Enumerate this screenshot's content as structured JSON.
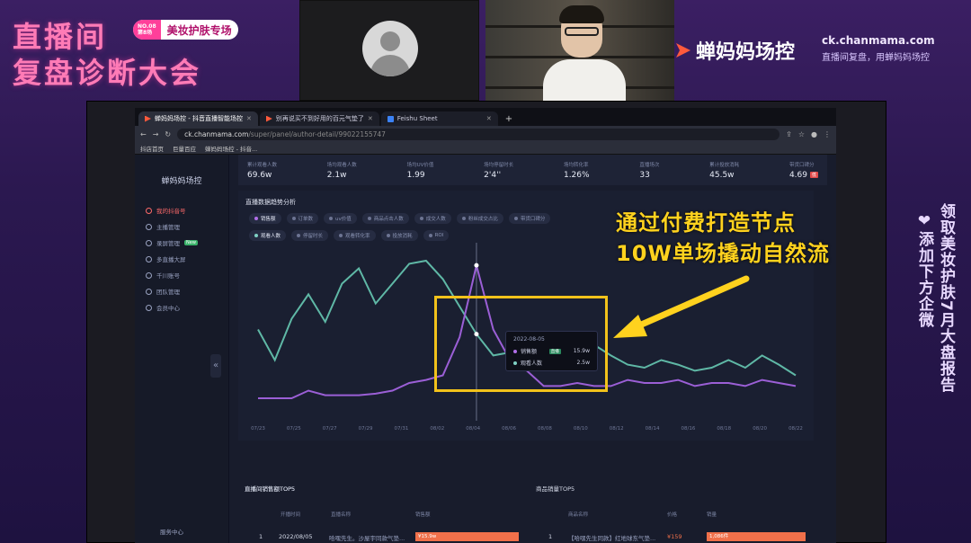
{
  "event": {
    "line1": "直播间",
    "line2": "复盘诊断大会",
    "badge_no": "NO.08",
    "badge_sub": "第8场",
    "badge_label": "美妆护肤专场"
  },
  "brand": {
    "name": "蝉妈妈场控",
    "url": "ck.chanmama.com",
    "tagline": "直播间复盘，用蝉妈妈场控"
  },
  "side_banner": {
    "col1": "领取美妆护肤7月大盘报告",
    "col2": "添加下方企微"
  },
  "annotation": {
    "line1": "通过付费打造节点",
    "line2": "10W单场撬动自然流"
  },
  "browser": {
    "tabs": [
      {
        "label": "蝉妈妈场控 - 抖音直播智能场控",
        "icon": "chanmama-icon"
      },
      {
        "label": "别再说买不到好用的百元气垫了",
        "icon": "chanmama-icon"
      },
      {
        "label": "Feishu Sheet",
        "icon": "feishu-icon"
      }
    ],
    "url_host": "ck.chanmama.com",
    "url_path": "/super/panel/author-detail/99022155747",
    "bookmarks": [
      "抖店首页",
      "巨量百应",
      "蝉妈妈场控 - 抖音..."
    ]
  },
  "sidebar": {
    "logo": "蝉妈妈场控",
    "items": [
      {
        "label": "我的抖音号",
        "active": true
      },
      {
        "label": "主播管理",
        "active": false
      },
      {
        "label": "录屏管理",
        "active": false,
        "badge": "New"
      },
      {
        "label": "多直播大屏",
        "active": false
      },
      {
        "label": "千川账号",
        "active": false
      },
      {
        "label": "团队管理",
        "active": false
      },
      {
        "label": "会员中心",
        "active": false
      }
    ],
    "footer": "服务中心"
  },
  "stats": [
    {
      "label": "累计观看人数",
      "value": "69.6w"
    },
    {
      "label": "场均观看人数",
      "value": "2.1w"
    },
    {
      "label": "场均UV价值",
      "value": "1.99"
    },
    {
      "label": "场均停留时长",
      "value": "2'4''"
    },
    {
      "label": "场均转化率",
      "value": "1.26%"
    },
    {
      "label": "直播场次",
      "value": "33"
    },
    {
      "label": "累计投放消耗",
      "value": "45.5w"
    },
    {
      "label": "带货口碑分",
      "value": "4.69",
      "tag": "低"
    }
  ],
  "trend": {
    "title": "直播数据趋势分析",
    "chips_row1": [
      {
        "label": "销售额",
        "on": true,
        "color": "#b06ee8"
      },
      {
        "label": "订单数",
        "on": false
      },
      {
        "label": "uv价值",
        "on": false
      },
      {
        "label": "商品点击人数",
        "on": false
      },
      {
        "label": "成交人数",
        "on": false
      },
      {
        "label": "粉丝成交占比",
        "on": false
      },
      {
        "label": "带货口碑分",
        "on": false
      }
    ],
    "chips_row2": [
      {
        "label": "观看人数",
        "on": true,
        "color": "#7fd1c4"
      },
      {
        "label": "停留时长",
        "on": false
      },
      {
        "label": "观看转化率",
        "on": false
      },
      {
        "label": "投放消耗",
        "on": false
      },
      {
        "label": "ROI",
        "on": false
      }
    ],
    "tooltip": {
      "date": "2022-08-05",
      "rows": [
        {
          "name": "销售额",
          "tag": "直播",
          "value": "15.9w",
          "color": "#b06ee8"
        },
        {
          "name": "观看人数",
          "value": "2.5w",
          "color": "#7fd1c4"
        }
      ]
    }
  },
  "chart_data": {
    "type": "line",
    "x": [
      "07/23",
      "07/25",
      "07/27",
      "07/29",
      "07/31",
      "08/02",
      "08/04",
      "08/06",
      "08/08",
      "08/10",
      "08/12",
      "08/14",
      "08/16",
      "08/18",
      "08/20",
      "08/22"
    ],
    "series": [
      {
        "name": "观看人数",
        "color": "#5fb8a6",
        "values": [
          0.55,
          0.35,
          0.62,
          0.78,
          0.6,
          0.85,
          0.95,
          0.72,
          0.85,
          0.98,
          1.0,
          0.88,
          0.7,
          0.52,
          0.38,
          0.4,
          0.42,
          0.3,
          0.4,
          0.4,
          0.45,
          0.38,
          0.32,
          0.3,
          0.35,
          0.32,
          0.28,
          0.3,
          0.35,
          0.3,
          0.38,
          0.32,
          0.25
        ]
      },
      {
        "name": "销售额",
        "color": "#9b5fd6",
        "values": [
          0.1,
          0.1,
          0.1,
          0.15,
          0.12,
          0.12,
          0.12,
          0.13,
          0.15,
          0.2,
          0.22,
          0.25,
          0.5,
          0.97,
          0.55,
          0.35,
          0.28,
          0.18,
          0.18,
          0.2,
          0.18,
          0.18,
          0.22,
          0.2,
          0.2,
          0.22,
          0.18,
          0.2,
          0.2,
          0.18,
          0.22,
          0.2,
          0.18
        ]
      }
    ],
    "highlight_index": 13
  },
  "bottom": {
    "left_title": "直播间销售额TOP5",
    "left_headers": [
      "开播时间",
      "直播名称",
      "销售额"
    ],
    "left_row": {
      "rank": "1",
      "date": "2022/08/05",
      "name": "哈嘿先生。沙屋宇同款气垫...",
      "value": "¥15.9w"
    },
    "right_title": "商品销量TOP5",
    "right_headers": [
      "商品名称",
      "价格",
      "销量"
    ],
    "right_row": {
      "rank": "1",
      "name": "【哈嘿先生同款】红地球东气垫...",
      "price": "¥159",
      "value": "1,086件"
    }
  }
}
